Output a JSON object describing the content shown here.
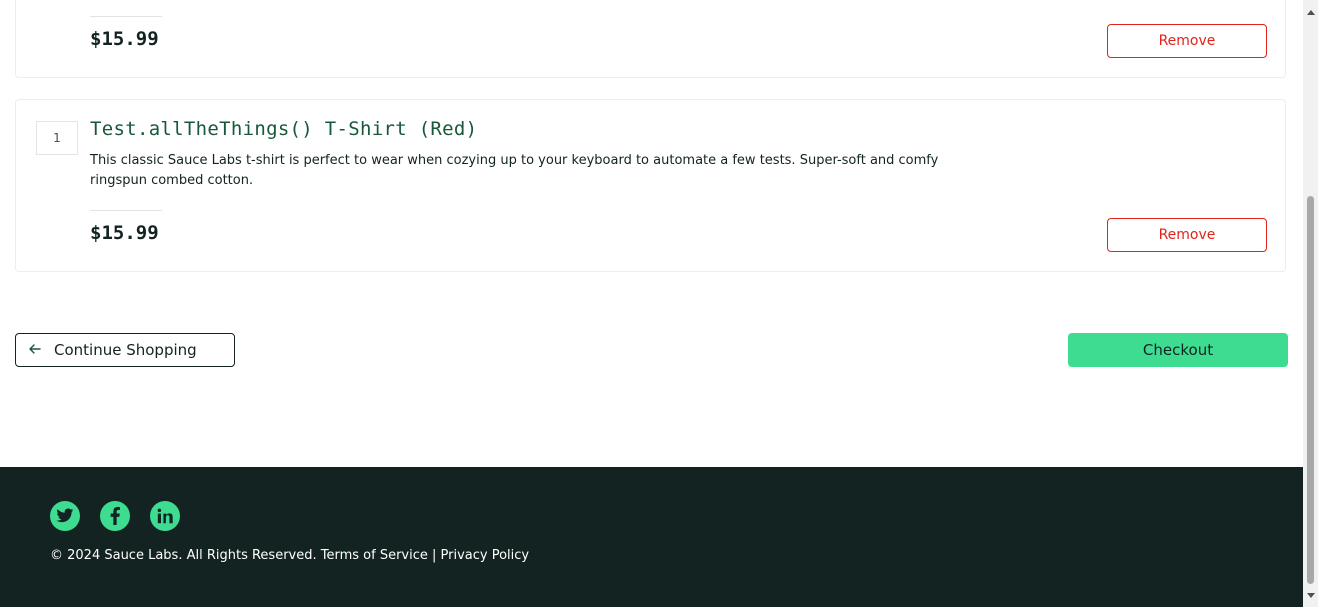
{
  "cart": {
    "items": [
      {
        "quantity": "",
        "name": "",
        "description": "",
        "price": "$15.99",
        "remove_label": "Remove"
      },
      {
        "quantity": "1",
        "name": "Test.allTheThings() T-Shirt (Red)",
        "description": "This classic Sauce Labs t-shirt is perfect to wear when cozying up to your keyboard to automate a few tests. Super-soft and comfy ringspun combed cotton.",
        "price": "$15.99",
        "remove_label": "Remove"
      }
    ],
    "continue_shopping_label": "Continue Shopping",
    "checkout_label": "Checkout"
  },
  "footer": {
    "social": [
      {
        "icon": "twitter-icon"
      },
      {
        "icon": "facebook-icon"
      },
      {
        "icon": "linkedin-icon"
      }
    ],
    "copyright": "© 2024 Sauce Labs. All Rights Reserved. Terms of Service | Privacy Policy"
  },
  "colors": {
    "accent_green": "#3ddc91",
    "footer_bg": "#132322",
    "remove_red": "#e2231a",
    "item_name_green": "#18583a"
  }
}
